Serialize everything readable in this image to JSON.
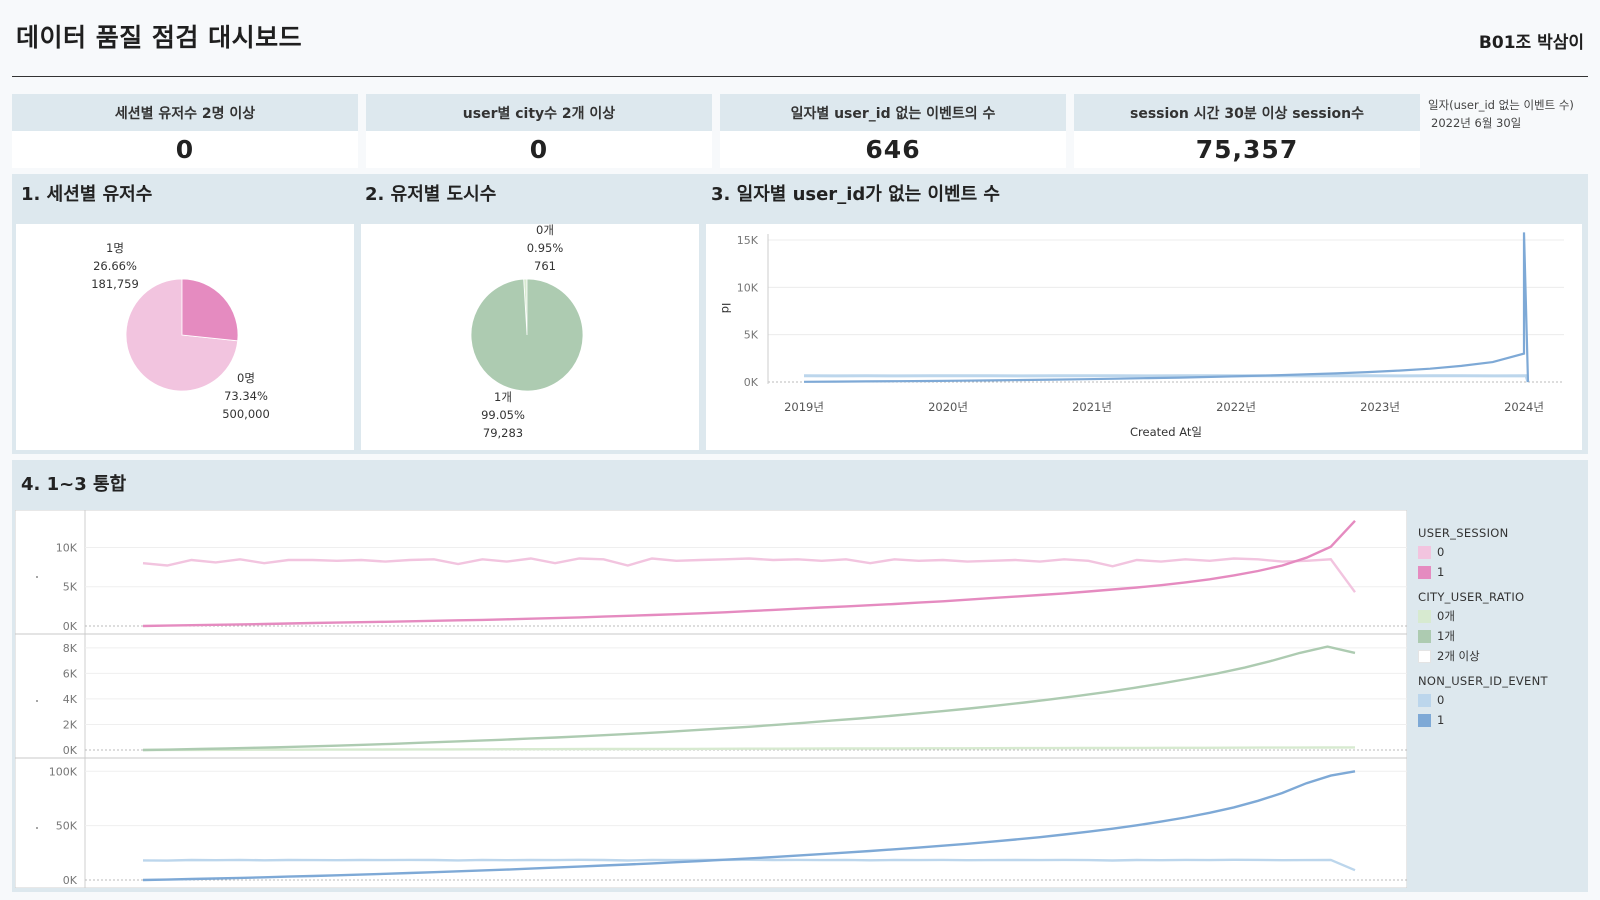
{
  "header": {
    "title": "데이터 품질 점검 대시보드",
    "author": "B01조 박삼이"
  },
  "kpis": [
    {
      "label": "세션별 유저수 2명 이상",
      "value": "0"
    },
    {
      "label": "user별 city수 2개 이상",
      "value": "0"
    },
    {
      "label": "일자별 user_id 없는 이벤트의 수",
      "value": "646"
    },
    {
      "label": "session 시간 30분 이상 session수",
      "value": "75,357"
    }
  ],
  "date_note": {
    "label": "일자(user_id 없는 이벤트 수)",
    "value": "2022년 6월 30일"
  },
  "sections": {
    "s1": "1. 세션별 유저수",
    "s2": "2. 유저별 도시수",
    "s3": "3. 일자별 user_id가 없는 이벤트 수",
    "s4": "4. 1~3 통합"
  },
  "colors": {
    "pink_light": "#f2c4df",
    "pink_dark": "#e58bc0",
    "green_light": "#d7ead0",
    "green_dark": "#adcbb1",
    "blue_light": "#bcd6ec",
    "blue_dark": "#7ea9d6"
  },
  "chart_data": [
    {
      "type": "pie",
      "title": "1. 세션별 유저수",
      "slices": [
        {
          "label": "0명",
          "percent": "73.34%",
          "count": "500,000",
          "value": 500000,
          "color": "#f2c4df"
        },
        {
          "label": "1명",
          "percent": "26.66%",
          "count": "181,759",
          "value": 181759,
          "color": "#e58bc0"
        }
      ]
    },
    {
      "type": "pie",
      "title": "2. 유저별 도시수",
      "slices": [
        {
          "label": "0개",
          "percent": "0.95%",
          "count": "761",
          "value": 761,
          "color": "#d7ead0"
        },
        {
          "label": "1개",
          "percent": "99.05%",
          "count": "79,283",
          "value": 79283,
          "color": "#adcbb1"
        }
      ]
    },
    {
      "type": "line",
      "title": "3. 일자별 user_id가 없는 이벤트 수",
      "xlabel": "Created At일",
      "ylabel": "Id",
      "x_ticks": [
        "2019년",
        "2020년",
        "2021년",
        "2022년",
        "2023년",
        "2024년"
      ],
      "y_ticks": [
        "0K",
        "5K",
        "10K",
        "15K"
      ],
      "ylim": [
        0,
        15000
      ],
      "series": [
        {
          "values": [
            650,
            640,
            660,
            645,
            655,
            650,
            660,
            648,
            652,
            655,
            660,
            645,
            650,
            658,
            652,
            650,
            640,
            655,
            650,
            645,
            650,
            652,
            648,
            650,
            0
          ]
        },
        {
          "values": [
            20,
            40,
            60,
            80,
            110,
            140,
            170,
            210,
            250,
            300,
            350,
            410,
            470,
            540,
            620,
            700,
            800,
            910,
            1050,
            1200,
            1400,
            1700,
            2100,
            3000,
            15800,
            0
          ]
        }
      ]
    },
    {
      "type": "line",
      "title": "4. 1~3 통합",
      "panels": [
        {
          "legend_title": "USER_SESSION",
          "y_ticks": [
            "0K",
            "5K",
            "10K"
          ],
          "ylim": [
            0,
            13500
          ],
          "series": [
            {
              "name": "0",
              "color": "#f2c4df",
              "values": [
                8000,
                7700,
                8400,
                8100,
                8500,
                8000,
                8400,
                8400,
                8300,
                8400,
                8200,
                8400,
                8500,
                7900,
                8500,
                8200,
                8600,
                8000,
                8600,
                8500,
                7700,
                8600,
                8300,
                8400,
                8500,
                8600,
                8400,
                8500,
                8300,
                8500,
                8000,
                8500,
                8300,
                8400,
                8200,
                8300,
                8400,
                8200,
                8500,
                8300,
                7600,
                8400,
                8200,
                8500,
                8300,
                8600,
                8500,
                8200,
                8300,
                8500,
                4300
              ]
            },
            {
              "name": "1",
              "color": "#e58bc0",
              "values": [
                0,
                50,
                100,
                150,
                200,
                260,
                320,
                380,
                430,
                480,
                540,
                600,
                660,
                720,
                780,
                850,
                930,
                1010,
                1100,
                1200,
                1300,
                1400,
                1500,
                1620,
                1750,
                1900,
                2050,
                2200,
                2350,
                2500,
                2650,
                2800,
                2980,
                3150,
                3350,
                3550,
                3750,
                3950,
                4150,
                4400,
                4650,
                4900,
                5200,
                5550,
                5950,
                6450,
                7000,
                7700,
                8700,
                10100,
                13400
              ]
            }
          ]
        },
        {
          "legend_title": "CITY_USER_RATIO",
          "y_ticks": [
            "0K",
            "2K",
            "4K",
            "6K",
            "8K"
          ],
          "ylim": [
            0,
            8300
          ],
          "series": [
            {
              "name": "0개",
              "color": "#d7ead0",
              "values": [
                0,
                5,
                10,
                15,
                20,
                25,
                30,
                35,
                40,
                45,
                50,
                55,
                60,
                65,
                70,
                75,
                80,
                85,
                90,
                95,
                100,
                105,
                110,
                115,
                120,
                125,
                130,
                135,
                140,
                145,
                150,
                155,
                160,
                165,
                170,
                175,
                180,
                185,
                190,
                195,
                200
              ]
            },
            {
              "name": "1개",
              "color": "#adcbb1",
              "values": [
                0,
                30,
                80,
                120,
                170,
                220,
                280,
                340,
                410,
                480,
                560,
                640,
                720,
                800,
                890,
                980,
                1080,
                1190,
                1300,
                1420,
                1550,
                1680,
                1820,
                1970,
                2130,
                2300,
                2470,
                2650,
                2840,
                3040,
                3250,
                3480,
                3720,
                3980,
                4250,
                4550,
                4870,
                5220,
                5600,
                6000,
                6450,
                7000,
                7600,
                8100,
                7600
              ]
            },
            {
              "name": "2개 이상",
              "color": "#ffffff",
              "values": []
            }
          ]
        },
        {
          "legend_title": "NON_USER_ID_EVENT",
          "y_ticks": [
            "0K",
            "50K",
            "100K"
          ],
          "ylim": [
            0,
            103000
          ],
          "series": [
            {
              "name": "0",
              "color": "#bcd6ec",
              "values": [
                18000,
                17800,
                18400,
                18200,
                18500,
                18100,
                18400,
                18300,
                18200,
                18400,
                18300,
                18500,
                18400,
                18000,
                18500,
                18200,
                18400,
                18300,
                18600,
                18400,
                17900,
                18500,
                18300,
                18400,
                18500,
                18600,
                18400,
                18500,
                18300,
                18500,
                18100,
                18400,
                18300,
                18500,
                18200,
                18300,
                18400,
                18300,
                18500,
                18300,
                17900,
                18400,
                18200,
                18500,
                18300,
                18600,
                18500,
                18200,
                18300,
                18500,
                9000
              ]
            },
            {
              "name": "1",
              "color": "#7ea9d6",
              "values": [
                0,
                400,
                900,
                1400,
                1900,
                2500,
                3100,
                3700,
                4300,
                5000,
                5700,
                6400,
                7200,
                8000,
                8800,
                9600,
                10500,
                11400,
                12300,
                13300,
                14300,
                15300,
                16400,
                17500,
                18700,
                19900,
                21100,
                22400,
                23800,
                25200,
                26700,
                28200,
                29800,
                31500,
                33300,
                35200,
                37200,
                39400,
                41800,
                44400,
                47200,
                50300,
                53700,
                57500,
                61800,
                66800,
                72800,
                80000,
                89000,
                96000,
                100000
              ]
            }
          ]
        }
      ]
    }
  ]
}
